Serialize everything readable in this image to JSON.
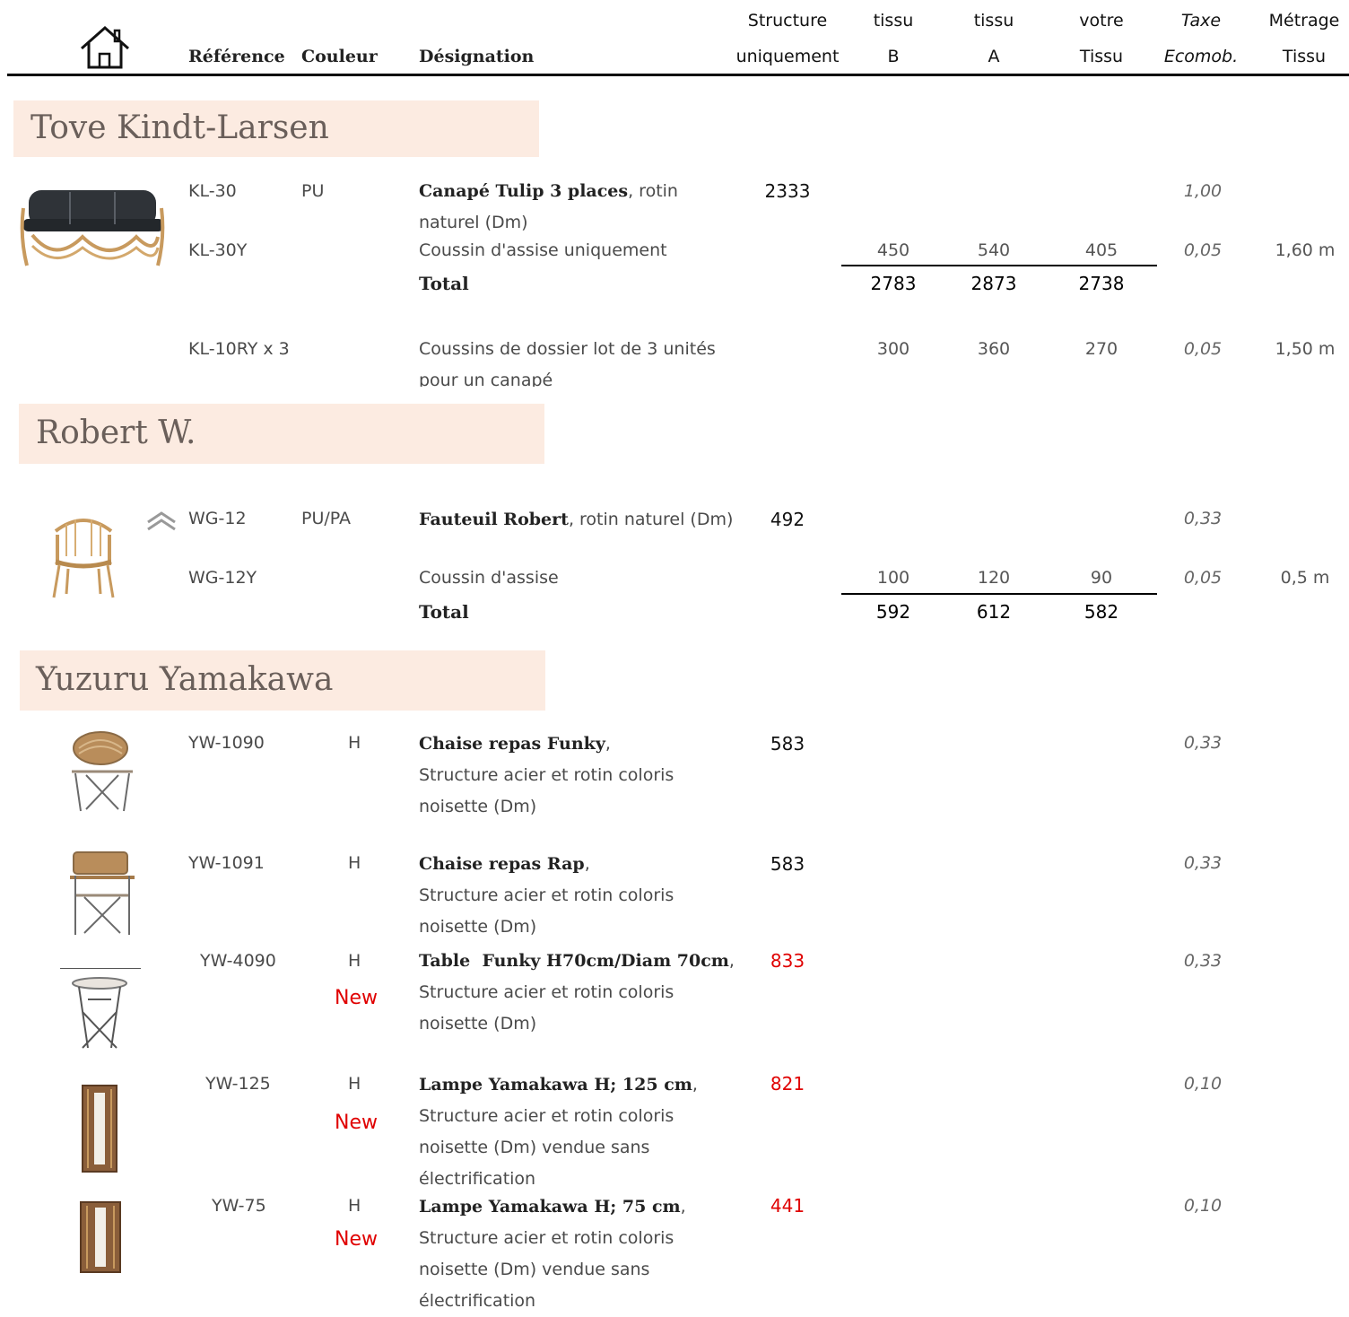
{
  "header": {
    "home_icon": "home-icon",
    "reference": "Référence",
    "couleur": "Couleur",
    "designation": "Désignation",
    "structure": [
      "Structure",
      "uniquement"
    ],
    "tissu_b": [
      "tissu",
      "B"
    ],
    "tissu_a": [
      "tissu",
      "A"
    ],
    "votre_tissu": [
      "votre",
      "Tissu"
    ],
    "taxe": [
      "Taxe",
      "Ecomob."
    ],
    "metrage": [
      "Métrage",
      "Tissu"
    ]
  },
  "sections": {
    "kindt": "Tove Kindt-Larsen",
    "robert": "Robert W.",
    "yamakawa": "Yuzuru Yamakawa"
  },
  "kl30": {
    "ref": "KL-30",
    "couleur": "PU",
    "name": "Canapé Tulip 3 places",
    "rest": ", rotin naturel (Dm)",
    "structure": "2333",
    "tax": "1,00"
  },
  "kl30y": {
    "ref": "KL-30Y",
    "desc": "Coussin d'assise uniquement",
    "b": "450",
    "a": "540",
    "votre": "405",
    "tax": "0,05",
    "metrage": "1,60 m"
  },
  "kl_total": {
    "label": "Total",
    "b": "2783",
    "a": "2873",
    "votre": "2738"
  },
  "kl10": {
    "ref": "KL-10RY x 3",
    "desc1": "Coussins de dossier lot de 3 unités",
    "desc2": "pour un canapé",
    "b": "300",
    "a": "360",
    "votre": "270",
    "tax": "0,05",
    "metrage": "1,50 m"
  },
  "wg12": {
    "ref": "WG-12",
    "couleur": "PU/PA",
    "name": "Fauteuil Robert",
    "rest": ", rotin naturel (Dm)",
    "structure": "492",
    "tax": "0,33"
  },
  "wg12y": {
    "ref": "WG-12Y",
    "desc": "Coussin d'assise",
    "b": "100",
    "a": "120",
    "votre": "90",
    "tax": "0,05",
    "metrage": "0,5 m"
  },
  "wg_total": {
    "label": "Total",
    "b": "592",
    "a": "612",
    "votre": "582"
  },
  "yw1090": {
    "ref": "YW-1090",
    "couleur": "H",
    "name": "Chaise repas Funky",
    "rest": ",",
    "l2": "Structure acier et rotin coloris",
    "l3": "noisette (Dm)",
    "structure": "583",
    "tax": "0,33"
  },
  "yw1091": {
    "ref": "YW-1091",
    "couleur": "H",
    "name": "Chaise repas Rap",
    "rest": ",",
    "l2": "Structure acier et rotin coloris",
    "l3": "noisette (Dm)",
    "structure": "583",
    "tax": "0,33"
  },
  "yw4090": {
    "ref": "YW-4090",
    "couleur": "H",
    "new": "New",
    "name": "Table  Funky H70cm/Diam 70cm",
    "rest": ",",
    "l2": "Structure acier et rotin coloris",
    "l3": "noisette (Dm)",
    "structure": "833",
    "tax": "0,33"
  },
  "yw125": {
    "ref": "YW-125",
    "couleur": "H",
    "new": "New",
    "name": "Lampe Yamakawa H; 125 cm",
    "rest": ",",
    "l2": "Structure acier et rotin coloris",
    "l3": "noisette (Dm) vendue sans",
    "l4": "électrification",
    "structure": "821",
    "tax": "0,10"
  },
  "yw75": {
    "ref": "YW-75",
    "couleur": "H",
    "new": "New",
    "name": "Lampe Yamakawa H; 75 cm",
    "rest": ",",
    "l2": "Structure acier et rotin coloris",
    "l3": "noisette (Dm) vendue sans",
    "l4": "électrification",
    "structure": "441",
    "tax": "0,10"
  },
  "colors": {
    "band": "#fcebe1",
    "new_red": "#e00000",
    "rattan": "#c89a5e"
  }
}
